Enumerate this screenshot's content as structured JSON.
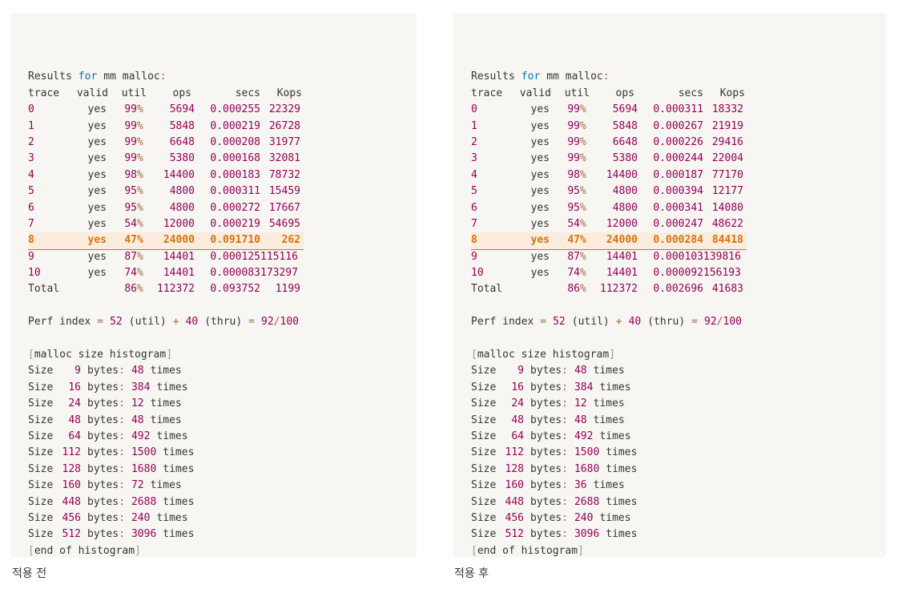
{
  "panels": [
    {
      "caption": "적용 전",
      "results_heading": {
        "prefix": "Results",
        "keyword": "for",
        "name": "mm malloc",
        "colon": ":"
      },
      "columns": [
        "trace",
        "valid",
        "util",
        "ops",
        "secs",
        "Kops"
      ],
      "rows": [
        {
          "trace": "0",
          "valid": "yes",
          "util": "99",
          "pct": "%",
          "ops": "5694",
          "secs": "0.000255",
          "kops": "22329"
        },
        {
          "trace": "1",
          "valid": "yes",
          "util": "99",
          "pct": "%",
          "ops": "5848",
          "secs": "0.000219",
          "kops": "26728"
        },
        {
          "trace": "2",
          "valid": "yes",
          "util": "99",
          "pct": "%",
          "ops": "6648",
          "secs": "0.000208",
          "kops": "31977"
        },
        {
          "trace": "3",
          "valid": "yes",
          "util": "99",
          "pct": "%",
          "ops": "5380",
          "secs": "0.000168",
          "kops": "32081"
        },
        {
          "trace": "4",
          "valid": "yes",
          "util": "98",
          "pct": "%",
          "ops": "14400",
          "secs": "0.000183",
          "kops": "78732"
        },
        {
          "trace": "5",
          "valid": "yes",
          "util": "95",
          "pct": "%",
          "ops": "4800",
          "secs": "0.000311",
          "kops": "15459"
        },
        {
          "trace": "6",
          "valid": "yes",
          "util": "95",
          "pct": "%",
          "ops": "4800",
          "secs": "0.000272",
          "kops": "17667"
        },
        {
          "trace": "7",
          "valid": "yes",
          "util": "54",
          "pct": "%",
          "ops": "12000",
          "secs": "0.000219",
          "kops": "54695"
        },
        {
          "trace": "8",
          "valid": "yes",
          "util": "47",
          "pct": "%",
          "ops": "24000",
          "secs": "0.091710",
          "kops": "262"
        },
        {
          "trace": "9",
          "valid": "yes",
          "util": "87",
          "pct": "%",
          "ops": "14401",
          "secs": "0.000125",
          "kops": "115116"
        },
        {
          "trace": "10",
          "valid": "yes",
          "util": "74",
          "pct": "%",
          "ops": "14401",
          "secs": "0.000083",
          "kops": "173297"
        }
      ],
      "total": {
        "label": "Total",
        "util": "86",
        "pct": "%",
        "ops": "112372",
        "secs": "0.093752",
        "kops": "1199"
      },
      "perf": {
        "label": "Perf index",
        "eq": "=",
        "util_score": "52",
        "util_label": "(util)",
        "plus": "+",
        "thru_score": "40",
        "thru_label": "(thru)",
        "eq2": "=",
        "total": "92",
        "slash": "/",
        "max": "100"
      },
      "hist_open": {
        "lb": "[",
        "text": "malloc size histogram",
        "rb": "]"
      },
      "histogram": [
        {
          "size": "9",
          "count": "48"
        },
        {
          "size": "16",
          "count": "384"
        },
        {
          "size": "24",
          "count": "12"
        },
        {
          "size": "48",
          "count": "48"
        },
        {
          "size": "64",
          "count": "492"
        },
        {
          "size": "112",
          "count": "1500"
        },
        {
          "size": "128",
          "count": "1680"
        },
        {
          "size": "160",
          "count": "72"
        },
        {
          "size": "448",
          "count": "2688"
        },
        {
          "size": "456",
          "count": "240"
        },
        {
          "size": "512",
          "count": "3096"
        }
      ],
      "hist_words": {
        "size": "Size",
        "bytes": "bytes",
        "colon": ":",
        "times": "times"
      },
      "hist_close": {
        "lb": "[",
        "text": "end of histogram",
        "rb": "]"
      }
    },
    {
      "caption": "적용 후",
      "results_heading": {
        "prefix": "Results",
        "keyword": "for",
        "name": "mm malloc",
        "colon": ":"
      },
      "columns": [
        "trace",
        "valid",
        "util",
        "ops",
        "secs",
        "Kops"
      ],
      "rows": [
        {
          "trace": "0",
          "valid": "yes",
          "util": "99",
          "pct": "%",
          "ops": "5694",
          "secs": "0.000311",
          "kops": "18332"
        },
        {
          "trace": "1",
          "valid": "yes",
          "util": "99",
          "pct": "%",
          "ops": "5848",
          "secs": "0.000267",
          "kops": "21919"
        },
        {
          "trace": "2",
          "valid": "yes",
          "util": "99",
          "pct": "%",
          "ops": "6648",
          "secs": "0.000226",
          "kops": "29416"
        },
        {
          "trace": "3",
          "valid": "yes",
          "util": "99",
          "pct": "%",
          "ops": "5380",
          "secs": "0.000244",
          "kops": "22004"
        },
        {
          "trace": "4",
          "valid": "yes",
          "util": "98",
          "pct": "%",
          "ops": "14400",
          "secs": "0.000187",
          "kops": "77170"
        },
        {
          "trace": "5",
          "valid": "yes",
          "util": "95",
          "pct": "%",
          "ops": "4800",
          "secs": "0.000394",
          "kops": "12177"
        },
        {
          "trace": "6",
          "valid": "yes",
          "util": "95",
          "pct": "%",
          "ops": "4800",
          "secs": "0.000341",
          "kops": "14080"
        },
        {
          "trace": "7",
          "valid": "yes",
          "util": "54",
          "pct": "%",
          "ops": "12000",
          "secs": "0.000247",
          "kops": "48622"
        },
        {
          "trace": "8",
          "valid": "yes",
          "util": "47",
          "pct": "%",
          "ops": "24000",
          "secs": "0.000284",
          "kops": "84418"
        },
        {
          "trace": "9",
          "valid": "yes",
          "util": "87",
          "pct": "%",
          "ops": "14401",
          "secs": "0.000103",
          "kops": "139816"
        },
        {
          "trace": "10",
          "valid": "yes",
          "util": "74",
          "pct": "%",
          "ops": "14401",
          "secs": "0.000092",
          "kops": "156193"
        }
      ],
      "total": {
        "label": "Total",
        "util": "86",
        "pct": "%",
        "ops": "112372",
        "secs": "0.002696",
        "kops": "41683"
      },
      "perf": {
        "label": "Perf index",
        "eq": "=",
        "util_score": "52",
        "util_label": "(util)",
        "plus": "+",
        "thru_score": "40",
        "thru_label": "(thru)",
        "eq2": "=",
        "total": "92",
        "slash": "/",
        "max": "100"
      },
      "hist_open": {
        "lb": "[",
        "text": "malloc size histogram",
        "rb": "]"
      },
      "histogram": [
        {
          "size": "9",
          "count": "48"
        },
        {
          "size": "16",
          "count": "384"
        },
        {
          "size": "24",
          "count": "12"
        },
        {
          "size": "48",
          "count": "48"
        },
        {
          "size": "64",
          "count": "492"
        },
        {
          "size": "112",
          "count": "1500"
        },
        {
          "size": "128",
          "count": "1680"
        },
        {
          "size": "160",
          "count": "36"
        },
        {
          "size": "448",
          "count": "2688"
        },
        {
          "size": "456",
          "count": "240"
        },
        {
          "size": "512",
          "count": "3096"
        }
      ],
      "hist_words": {
        "size": "Size",
        "bytes": "bytes",
        "colon": ":",
        "times": "times"
      },
      "hist_close": {
        "lb": "[",
        "text": "end of histogram",
        "rb": "]"
      }
    }
  ],
  "highlight_trace": "8"
}
